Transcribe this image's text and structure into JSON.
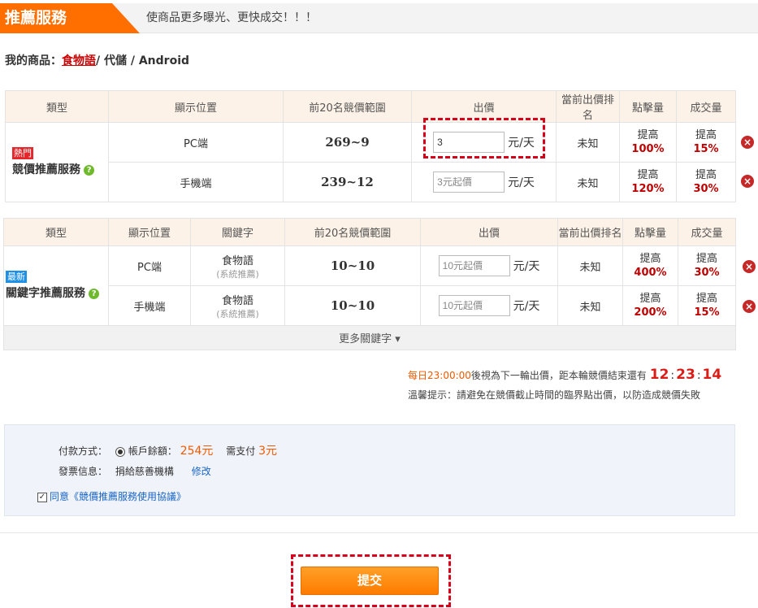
{
  "header": {
    "title": "推薦服務",
    "subtitle": "使商品更多曝光、更快成交！！！"
  },
  "product": {
    "label": "我的商品：",
    "category_link": "食物語",
    "path_rest": "/ 代儲 / Android"
  },
  "bidding_table": {
    "columns": [
      "類型",
      "顯示位置",
      "前20名競價範圍",
      "出價",
      "當前出價排名",
      "點擊量",
      "成交量"
    ],
    "type_badge": "熱門",
    "type_name": "競價推薦服務",
    "rows": [
      {
        "position": "PC端",
        "range": "269~9",
        "bid_value": "3",
        "bid_placeholder": "",
        "unit": "元/天",
        "rank": "未知",
        "click_label": "提高",
        "click_pct": "100%",
        "deal_label": "提高",
        "deal_pct": "15%"
      },
      {
        "position": "手機端",
        "range": "239~12",
        "bid_value": "",
        "bid_placeholder": "3元起價",
        "unit": "元/天",
        "rank": "未知",
        "click_label": "提高",
        "click_pct": "120%",
        "deal_label": "提高",
        "deal_pct": "30%"
      }
    ]
  },
  "keyword_table": {
    "columns": [
      "類型",
      "顯示位置",
      "關鍵字",
      "前20名競價範圍",
      "出價",
      "當前出價排名",
      "點擊量",
      "成交量"
    ],
    "type_badge": "最新",
    "type_name": "關鍵字推薦服務",
    "rows": [
      {
        "position": "PC端",
        "keyword": "食物語",
        "keyword_note": "(系統推薦)",
        "range": "10~10",
        "bid_placeholder": "10元起價",
        "unit": "元/天",
        "rank": "未知",
        "click_label": "提高",
        "click_pct": "400%",
        "deal_label": "提高",
        "deal_pct": "30%"
      },
      {
        "position": "手機端",
        "keyword": "食物語",
        "keyword_note": "(系統推薦)",
        "range": "10~10",
        "bid_placeholder": "10元起價",
        "unit": "元/天",
        "rank": "未知",
        "click_label": "提高",
        "click_pct": "200%",
        "deal_label": "提高",
        "deal_pct": "15%"
      }
    ],
    "more_label": "更多關鍵字 ▾"
  },
  "countdown": {
    "time_prefix": "每日23:00:00",
    "text": "後視為下一輪出價，距本輪競價結束還有",
    "hours": "12",
    "minutes": "23",
    "seconds": "14",
    "tip": "溫馨提示：請避免在競價截止時間的臨界點出價，以防造成競價失敗"
  },
  "payment": {
    "method_label": "付款方式：",
    "balance_label": "帳戶餘額：",
    "balance_value": "254元",
    "need_label": "需支付",
    "need_value": "3元",
    "invoice_label": "發票信息：",
    "invoice_value": "捐給慈善機構",
    "modify_link": "修改",
    "agree_label": "同意《競價推薦服務使用協議》"
  },
  "submit_label": "提交",
  "colors": {
    "accent": "#ff6f00",
    "highlight": "#d9001b",
    "pct_red": "#c00000"
  }
}
